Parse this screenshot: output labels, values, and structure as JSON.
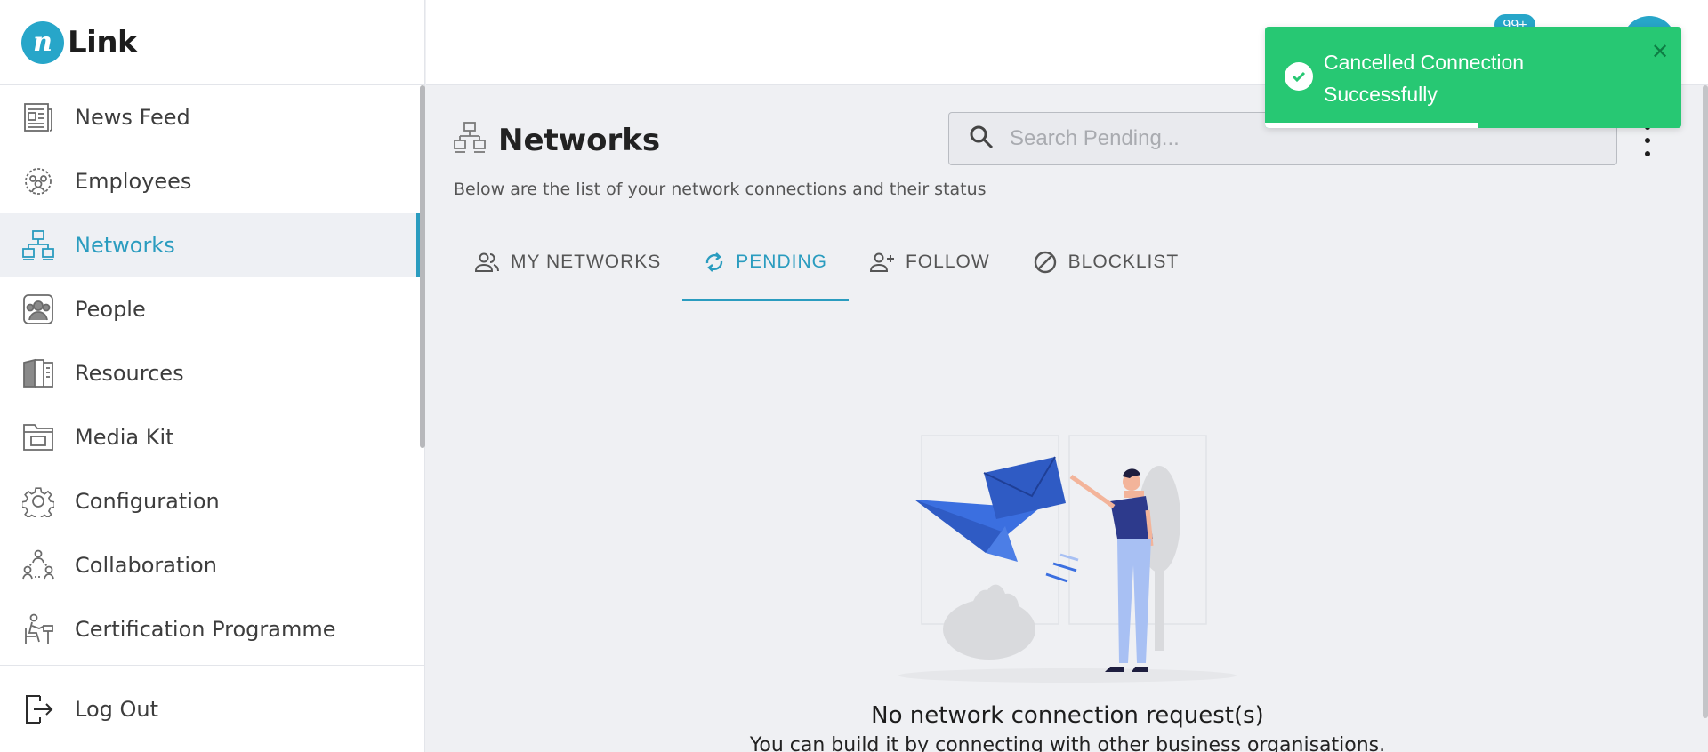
{
  "brand": {
    "logo_mark": "n",
    "name": "Link"
  },
  "sidebar": {
    "items": [
      {
        "label": "News Feed",
        "icon": "newspaper-icon",
        "active": false
      },
      {
        "label": "Employees",
        "icon": "employees-icon",
        "active": false
      },
      {
        "label": "Networks",
        "icon": "network-icon",
        "active": true
      },
      {
        "label": "People",
        "icon": "people-icon",
        "active": false
      },
      {
        "label": "Resources",
        "icon": "book-icon",
        "active": false
      },
      {
        "label": "Media Kit",
        "icon": "media-kit-icon",
        "active": false
      },
      {
        "label": "Configuration",
        "icon": "gear-icon",
        "active": false
      },
      {
        "label": "Collaboration",
        "icon": "collaboration-icon",
        "active": false
      },
      {
        "label": "Certification Programme",
        "icon": "certification-icon",
        "active": false
      }
    ],
    "logout_label": "Log Out"
  },
  "topbar": {
    "notification_count": "99+"
  },
  "page": {
    "title": "Networks",
    "subtitle": "Below are the list of your network connections and their status",
    "search_placeholder": "Search Pending..."
  },
  "tabs": [
    {
      "label": "MY NETWORKS",
      "icon": "people-outline-icon",
      "active": false
    },
    {
      "label": "PENDING",
      "icon": "refresh-icon",
      "active": true
    },
    {
      "label": "FOLLOW",
      "icon": "person-add-icon",
      "active": false
    },
    {
      "label": "BLOCKLIST",
      "icon": "block-icon",
      "active": false
    }
  ],
  "empty_state": {
    "title": "No network connection request(s)",
    "subtitle": "You can build it by connecting with other business organisations."
  },
  "toast": {
    "message": "Cancelled Connection Successfully",
    "close": "✕",
    "progress": 0.51
  },
  "colors": {
    "accent": "#2a9cbf",
    "toast_green": "#27c873",
    "illustration_blue": "#3b6fe0"
  }
}
